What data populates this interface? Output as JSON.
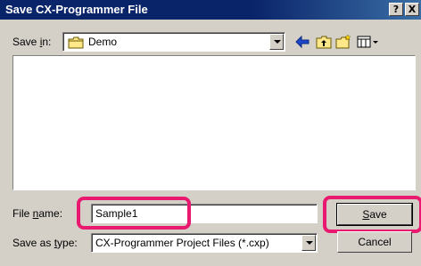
{
  "window": {
    "title": "Save CX-Programmer File",
    "help_btn": "?",
    "close_btn": "X"
  },
  "save_in": {
    "label_prefix": "Save ",
    "label_underlined": "i",
    "label_suffix": "n:",
    "value": "Demo"
  },
  "file_name": {
    "label_prefix": "File ",
    "label_underlined": "n",
    "label_suffix": "ame:",
    "value": "Sample1"
  },
  "save_as_type": {
    "label_prefix": "Save as ",
    "label_underlined": "t",
    "label_suffix": "ype:",
    "value": "CX-Programmer Project Files (*.cxp)"
  },
  "buttons": {
    "save_underlined": "S",
    "save_rest": "ave",
    "cancel": "Cancel"
  },
  "icons": [
    "folder-icon",
    "back-arrow-icon",
    "up-folder-icon",
    "new-folder-icon",
    "view-menu-icon"
  ],
  "colors": {
    "title_bar": "#0a246a",
    "highlight": "#e8196e",
    "face": "#d4d0c8"
  }
}
